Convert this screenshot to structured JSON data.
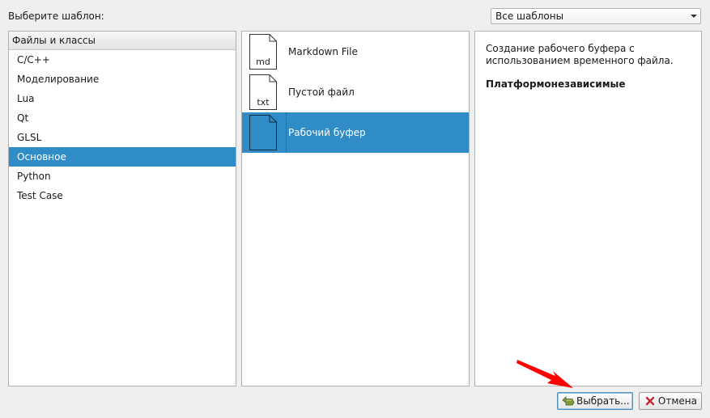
{
  "dialog": {
    "prompt_label": "Выберите шаблон:"
  },
  "filter": {
    "selected": "Все шаблоны",
    "icon": "chevron-down-icon"
  },
  "categories": {
    "header": "Файлы и классы",
    "items": [
      {
        "label": "C/C++",
        "selected": false
      },
      {
        "label": "Моделирование",
        "selected": false
      },
      {
        "label": "Lua",
        "selected": false
      },
      {
        "label": "Qt",
        "selected": false
      },
      {
        "label": "GLSL",
        "selected": false
      },
      {
        "label": "Основное",
        "selected": true
      },
      {
        "label": "Python",
        "selected": false
      },
      {
        "label": "Test Case",
        "selected": false
      }
    ]
  },
  "templates": {
    "items": [
      {
        "label": "Markdown File",
        "icon_text": "md",
        "selected": false
      },
      {
        "label": "Пустой файл",
        "icon_text": "txt",
        "selected": false
      },
      {
        "label": "Рабочий буфер",
        "icon_text": "",
        "selected": true
      }
    ]
  },
  "description": {
    "text": "Создание рабочего буфера с использованием временного файла.",
    "platform": "Платформонезависимые"
  },
  "buttons": {
    "choose_label": "Выбрать...",
    "choose_icon": "ok-icon",
    "cancel_label": "Отмена",
    "cancel_icon": "cancel-x-icon"
  },
  "colors": {
    "selection": "#308cc6",
    "annotation_arrow": "#ff0000"
  }
}
